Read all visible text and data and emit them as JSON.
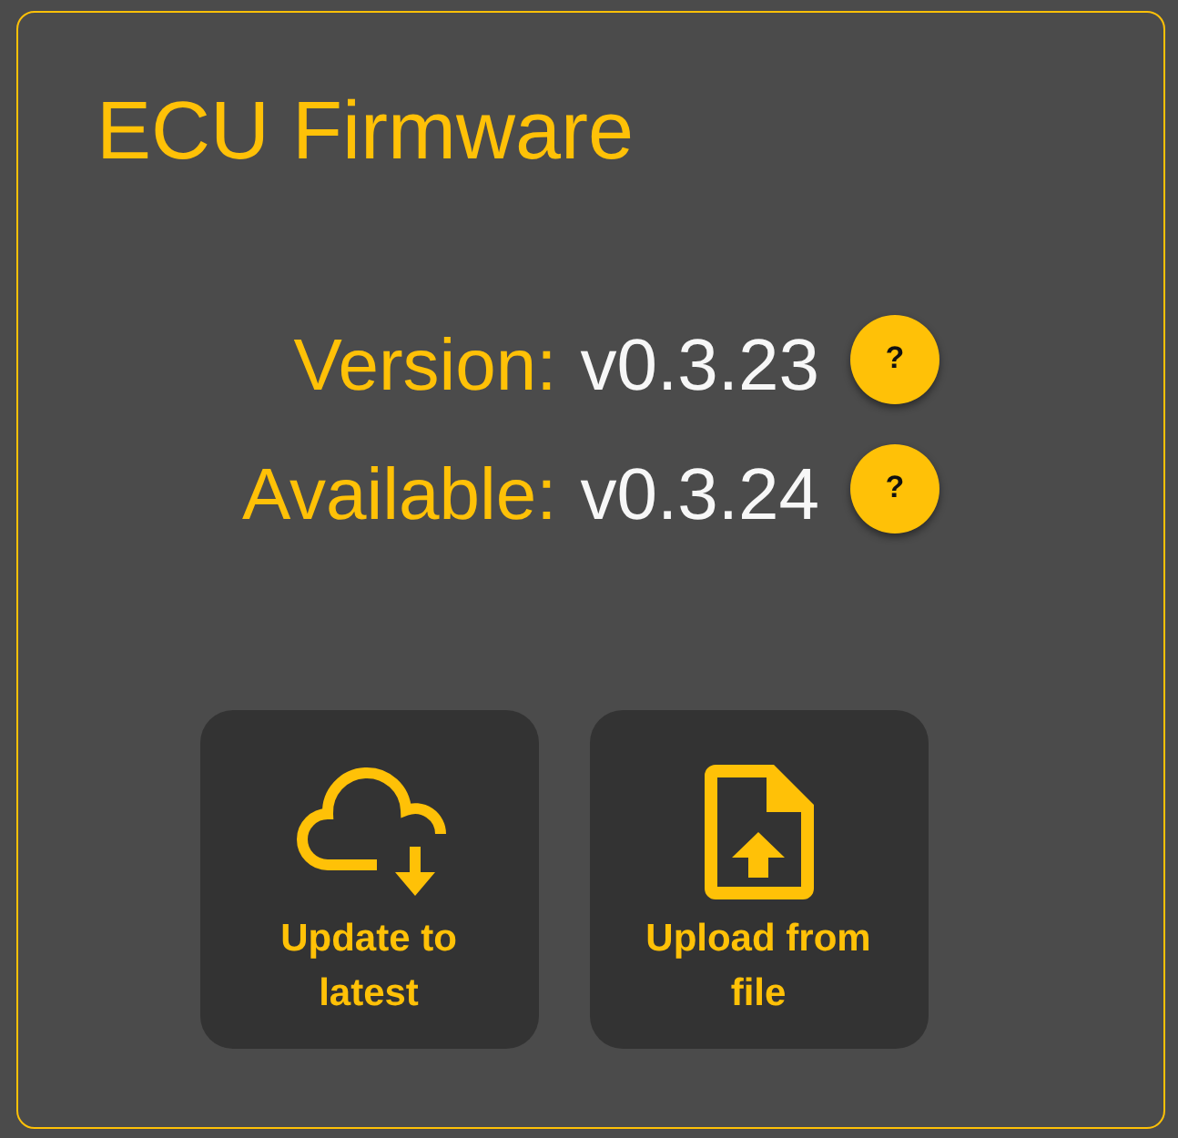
{
  "panel": {
    "title": "ECU Firmware"
  },
  "versions": [
    {
      "label": "Version:",
      "value": "v0.3.23",
      "help": "?"
    },
    {
      "label": "Available:",
      "value": "v0.3.24",
      "help": "?"
    }
  ],
  "actions": [
    {
      "kind": "cloud-download",
      "label": "Update to latest"
    },
    {
      "kind": "file-upload",
      "label": "Upload from file"
    }
  ]
}
